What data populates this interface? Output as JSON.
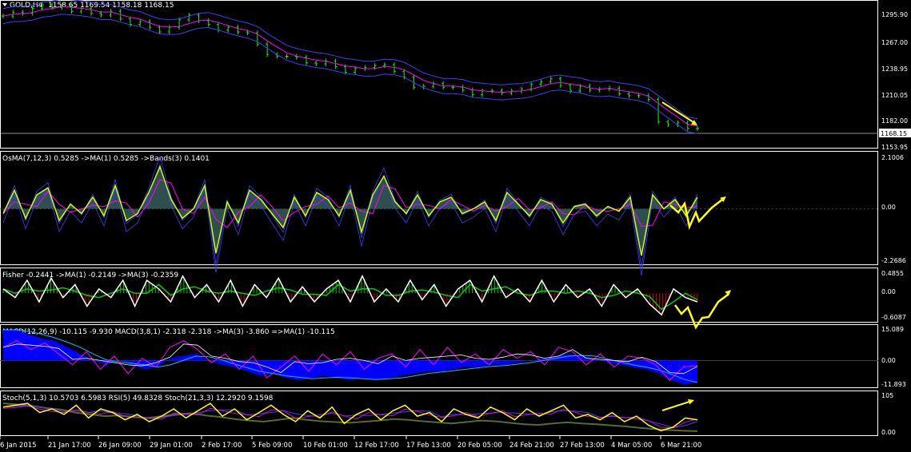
{
  "window": {
    "symbol_title": "GOLD,H4",
    "ohlc_readout": "1158.65 1169.54 1158.18 1168.15",
    "current_price_label": "1168.15"
  },
  "colors": {
    "background": "#000000",
    "frame": "#ffffff",
    "price_candles": "#00ff00",
    "bands": "#3d3dff",
    "ma_magenta": "#ff00ff",
    "osma_fill": "#2f4f4f",
    "osma_line": "#c8ff00",
    "fisher_line": "#ffffff",
    "fisher_green": "#00cc00",
    "fisher_red": "#cc0000",
    "macd_fill": "#0000ff",
    "macd_signal": "#00c0ff",
    "stoch_yellow": "#ffff00",
    "stoch_olive": "#556b2f",
    "annotation_arrow": "#ffff00",
    "price_line": "#c0c0c0"
  },
  "panels": [
    {
      "id": "price",
      "label": "",
      "yticks": [
        "1295.90",
        "1267.00",
        "1238.95",
        "1210.05",
        "1182.00",
        "1153.95"
      ]
    },
    {
      "id": "osma",
      "label": "OsMA(7,12,3) 0.5285  ->MA(1) 0.5285  ->Bands(3) 0.1401",
      "yticks": [
        "2.1006",
        "0.00",
        "-2.2686"
      ]
    },
    {
      "id": "fisher",
      "label": "Fisher -0.2441  ->MA(1) -0.2149  ->MA(3) -0.2359",
      "yticks": [
        "0.4855",
        "0.00",
        "-0.6087"
      ]
    },
    {
      "id": "macd",
      "label": "MACD(12,26,9) -10.115 -9.930  MACD(3,8,1) -2.318 -2.318  ->MA(3) -3.860  =>MA(1) -10.115",
      "yticks": [
        "15.089",
        "0.00",
        "-11.893"
      ]
    },
    {
      "id": "stoch",
      "label": "Stoch(5,1,3) 10.5703 6.5983  RSI(5) 49.8328  Stoch(21,3,3) 12.2920 9.1598",
      "yticks": [
        "105",
        "0.00"
      ]
    }
  ],
  "chart_data": {
    "type": "line",
    "title": "GOLD,H4",
    "x_tick_labels": [
      "6 Jan 2015",
      "21 Jan 17:00",
      "26 Jan 09:00",
      "29 Jan 01:00",
      "2 Feb 17:00",
      "5 Feb 09:00",
      "10 Feb 01:00",
      "12 Feb 17:00",
      "17 Feb 13:00",
      "20 Feb 05:00",
      "24 Feb 21:00",
      "27 Feb 13:00",
      "4 Mar 05:00",
      "6 Mar 21:00"
    ],
    "price_series": {
      "name": "GOLD,H4",
      "ylim": [
        1150,
        1300
      ],
      "values": [
        1288,
        1292,
        1291,
        1296,
        1300,
        1297,
        1299,
        1293,
        1296,
        1291,
        1289,
        1293,
        1285,
        1279,
        1282,
        1276,
        1271,
        1276,
        1284,
        1289,
        1283,
        1279,
        1273,
        1276,
        1271,
        1270,
        1258,
        1247,
        1245,
        1245,
        1244,
        1238,
        1237,
        1240,
        1234,
        1228,
        1232,
        1233,
        1235,
        1236,
        1229,
        1223,
        1212,
        1213,
        1216,
        1212,
        1212,
        1209,
        1204,
        1208,
        1208,
        1206,
        1208,
        1210,
        1215,
        1218,
        1221,
        1214,
        1208,
        1213,
        1209,
        1210,
        1211,
        1205,
        1203,
        1203,
        1199,
        1175,
        1172,
        1174,
        1168,
        1168
      ]
    },
    "osma_series": {
      "name": "OsMA",
      "ylim": [
        -2.2686,
        2.1006
      ],
      "values": [
        -0.2,
        0.8,
        -0.4,
        0.6,
        0.9,
        -0.5,
        0.2,
        -0.2,
        0.5,
        -0.3,
        1.0,
        -0.5,
        -0.2,
        0.7,
        1.8,
        0.4,
        -0.4,
        0.0,
        1.0,
        -1.9,
        0.3,
        -0.6,
        0.8,
        0.4,
        -0.2,
        -0.8,
        0.5,
        -0.3,
        0.7,
        0.4,
        -0.3,
        0.8,
        -1.0,
        0.6,
        1.4,
        0.3,
        -0.2,
        0.6,
        -0.3,
        0.3,
        0.5,
        -0.2,
        0.0,
        0.3,
        -0.5,
        0.7,
        0.2,
        -0.3,
        0.4,
        0.2,
        -0.6,
        0.1,
        0.2,
        -0.3,
        0.1,
        -0.1,
        0.5,
        -2.0,
        0.6,
        0.0,
        0.4,
        -0.3,
        0.5
      ]
    },
    "fisher_series": {
      "name": "Fisher",
      "ylim": [
        -0.6087,
        0.4855
      ],
      "values": [
        0.1,
        -0.1,
        0.3,
        -0.2,
        0.35,
        -0.1,
        0.2,
        -0.3,
        0.1,
        -0.1,
        0.3,
        -0.3,
        0.3,
        0.1,
        -0.2,
        0.4,
        -0.1,
        0.2,
        -0.2,
        0.3,
        -0.3,
        0.2,
        -0.1,
        0.35,
        -0.2,
        0.15,
        -0.2,
        0.1,
        0.3,
        -0.2,
        0.4,
        -0.2,
        0.1,
        -0.2,
        0.3,
        -0.15,
        0.2,
        -0.3,
        0.1,
        0.3,
        -0.2,
        0.4,
        -0.1,
        0.1,
        -0.2,
        0.3,
        -0.2,
        0.2,
        -0.1,
        0.1,
        -0.3,
        0.2,
        -0.1,
        0.1,
        -0.25,
        -0.5,
        0.1,
        -0.1,
        -0.2
      ]
    },
    "macd_series": {
      "name": "MACD(12,26,9)",
      "ylim": [
        -11.893,
        15.089
      ],
      "values": [
        14,
        14,
        12,
        10,
        9,
        6,
        3,
        0,
        -2,
        0,
        -2,
        -4,
        -3,
        1,
        2,
        3,
        0,
        -2,
        -3,
        -5,
        -7,
        -6,
        -8,
        -9,
        -8,
        -7,
        -8,
        -9,
        -8,
        -9,
        -8,
        -7,
        -6,
        -5,
        -5,
        -4,
        -3,
        -3,
        -2,
        -2,
        -1,
        0,
        1,
        2,
        3,
        2,
        1,
        -1,
        -2,
        -3,
        -4,
        -6,
        -9,
        -11,
        -10.1
      ]
    },
    "macd_signal_series": {
      "name": "MACD(3,8,1)",
      "ylim": [
        -11.893,
        15.089
      ],
      "values": [
        6,
        9,
        5,
        8,
        3,
        -2,
        4,
        -4,
        2,
        -6,
        1,
        -3,
        6,
        9,
        5,
        -1,
        3,
        -4,
        2,
        -8,
        -3,
        2,
        -5,
        3,
        -2,
        4,
        -4,
        1,
        3,
        -3,
        5,
        -2,
        6,
        -1,
        3,
        -2,
        5,
        1,
        4,
        -2,
        6,
        4,
        -2,
        3,
        -3,
        2,
        1,
        -2,
        -9,
        -3,
        -2.3
      ]
    },
    "stoch_series": {
      "name": "Stoch(5,1,3)",
      "ylim": [
        0,
        105
      ],
      "values": [
        75,
        80,
        85,
        60,
        70,
        55,
        80,
        45,
        70,
        60,
        40,
        55,
        35,
        50,
        70,
        45,
        65,
        85,
        50,
        70,
        40,
        60,
        80,
        55,
        35,
        65,
        45,
        75,
        30,
        55,
        70,
        40,
        65,
        80,
        50,
        60,
        35,
        70,
        55,
        45,
        75,
        60,
        40,
        70,
        50,
        65,
        80,
        45,
        55,
        40,
        60,
        35,
        50,
        25,
        10,
        20,
        45,
        40
      ]
    },
    "stoch_slow_series": {
      "name": "Stoch(21,3,3)",
      "ylim": [
        0,
        105
      ],
      "values": [
        85,
        82,
        78,
        72,
        68,
        60,
        55,
        50,
        52,
        48,
        45,
        50,
        55,
        58,
        52,
        48,
        42,
        38,
        35,
        40,
        45,
        40,
        36,
        34,
        32,
        35,
        38,
        42,
        40,
        36,
        33,
        30,
        34,
        38,
        36,
        32,
        28,
        26,
        30,
        33,
        30,
        28,
        25,
        22,
        18,
        15,
        12,
        10,
        9
      ]
    },
    "annotations": [
      {
        "panel": "price",
        "direction": "down",
        "meaning": "price falling"
      },
      {
        "panel": "osma",
        "direction": "up",
        "meaning": "zig-zag rising"
      },
      {
        "panel": "fisher",
        "direction": "up",
        "meaning": "zig-zag rising"
      },
      {
        "panel": "stoch",
        "direction": "up",
        "meaning": "rising"
      }
    ]
  }
}
